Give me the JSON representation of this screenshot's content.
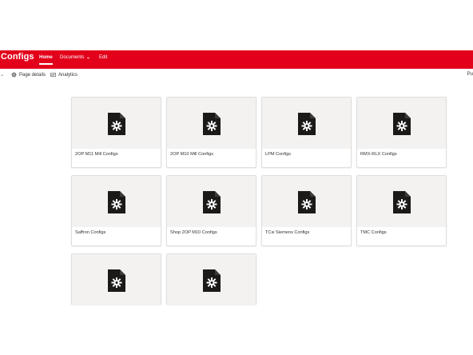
{
  "header": {
    "site_title": "Configs",
    "nav": [
      {
        "label": "Home",
        "active": true
      },
      {
        "label": "Documents",
        "has_dropdown": true
      },
      {
        "label": "Edit"
      }
    ],
    "accent_color": "#e3001b"
  },
  "command_bar": {
    "items": [
      {
        "label": "Page details",
        "icon": "gear-icon"
      },
      {
        "label": "Analytics",
        "icon": "analytics-icon"
      }
    ],
    "right_fragment": "Pu"
  },
  "tiles": [
    {
      "label": "2OP M11 Mill Configs",
      "icon": "config-file-icon"
    },
    {
      "label": "2OP M10 Mill Configs",
      "icon": "config-file-icon"
    },
    {
      "label": "LPM Configs",
      "icon": "config-file-icon"
    },
    {
      "label": "RMX-RLX Configs",
      "icon": "config-file-icon"
    },
    {
      "label": "Saffron Configs",
      "icon": "config-file-icon"
    },
    {
      "label": "Shop 2OP M10 Configs",
      "icon": "config-file-icon"
    },
    {
      "label": "TCsi Siemens Configs",
      "icon": "config-file-icon"
    },
    {
      "label": "TMC Configs",
      "icon": "config-file-icon"
    },
    {
      "label": "",
      "icon": "config-file-icon"
    },
    {
      "label": "",
      "icon": "config-file-icon"
    }
  ]
}
